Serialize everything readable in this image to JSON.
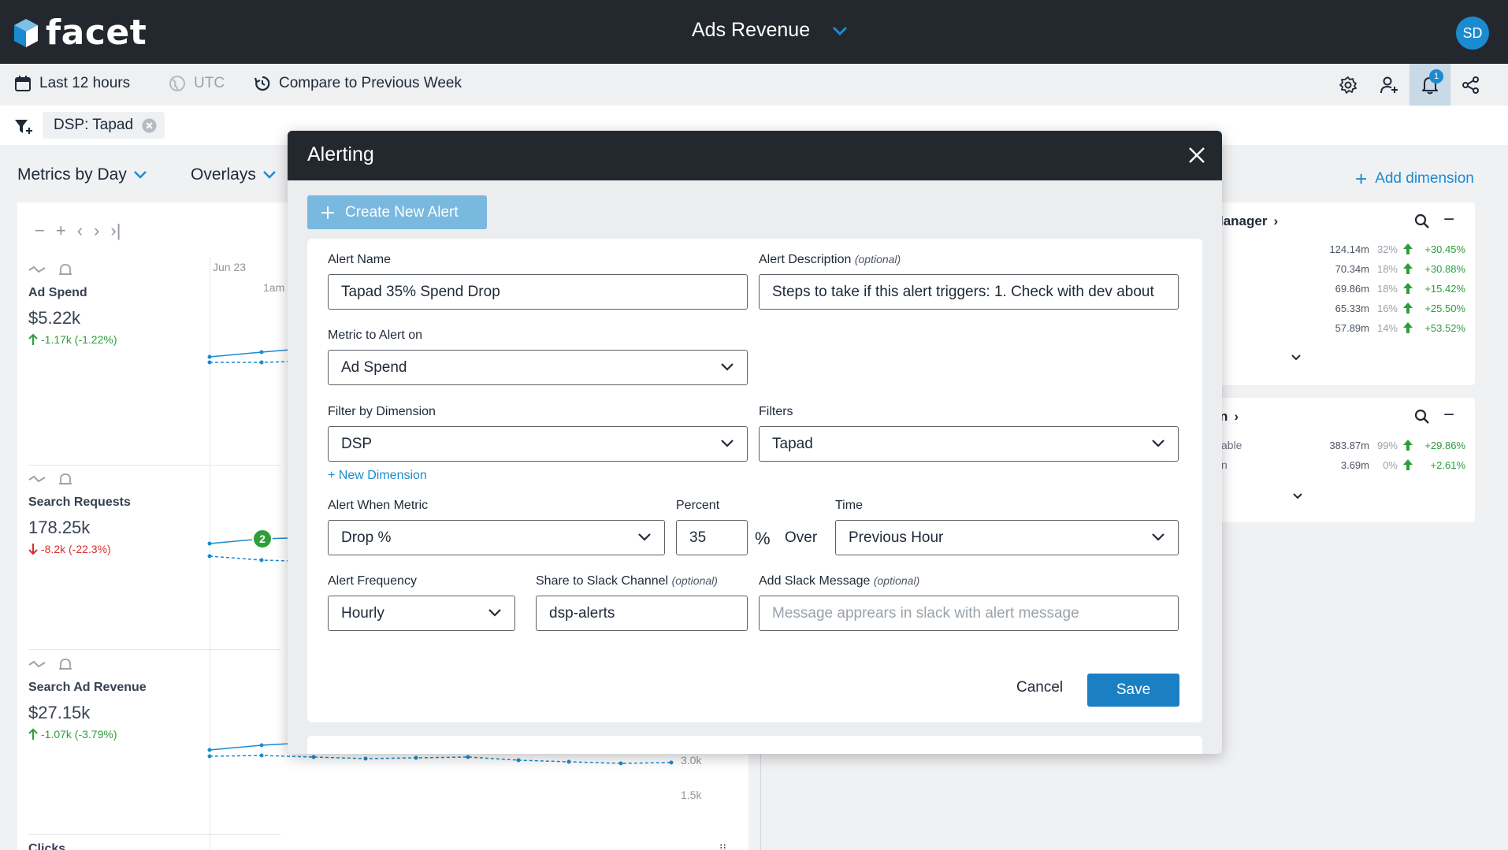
{
  "app": {
    "logo_text": "facet",
    "dashboard_title": "Ads Revenue",
    "avatar_initials": "SD"
  },
  "toolbar": {
    "time_range": "Last 12 hours",
    "timezone": "UTC",
    "compare": "Compare to Previous Week",
    "notification_count": "1"
  },
  "filters": {
    "chip_label": "DSP: Tapad"
  },
  "background": {
    "metrics_label": "Metrics by Day",
    "overlays_label": "Overlays",
    "add_dimension": "Add dimension",
    "chart_date": "Jun 23",
    "chart_time": "1am",
    "y_ticks": [
      "3.0k",
      "1.5k"
    ],
    "annotation_count": "2",
    "metrics": [
      {
        "title": "Ad Spend",
        "value": "$5.22k",
        "delta": "-1.17k (-1.22%)",
        "direction": "up",
        "color": "#2e9e3a"
      },
      {
        "title": "Search Requests",
        "value": "178.25k",
        "delta": "-8.2k (-22.3%)",
        "direction": "down",
        "color": "#d6312b"
      },
      {
        "title": "Search Ad Revenue",
        "value": "$27.15k",
        "delta": "-1.07k (-3.79%)",
        "direction": "up",
        "color": "#2e9e3a"
      },
      {
        "title": "Clicks"
      }
    ],
    "panel1": {
      "heading": "lanager",
      "rows": [
        {
          "value": "124.14m",
          "pct": "32%",
          "change": "+30.45%"
        },
        {
          "value": "70.34m",
          "pct": "18%",
          "change": "+30.88%"
        },
        {
          "value": "69.86m",
          "pct": "18%",
          "change": "+15.42%"
        },
        {
          "value": "65.33m",
          "pct": "16%",
          "change": "+25.50%"
        },
        {
          "value": "57.89m",
          "pct": "14%",
          "change": "+53.52%"
        }
      ]
    },
    "panel2": {
      "heading": "n",
      "rows": [
        {
          "label": "able",
          "value": "383.87m",
          "pct": "99%",
          "change": "+29.86%"
        },
        {
          "label": "n",
          "value": "3.69m",
          "pct": "0%",
          "change": "+2.61%"
        }
      ]
    }
  },
  "modal": {
    "title": "Alerting",
    "create_button": "Create New Alert",
    "alert_name_label": "Alert Name",
    "alert_name_value": "Tapad 35% Spend Drop",
    "description_label": "Alert Description",
    "description_optional": "(optional)",
    "description_value": "Steps to take if this alert triggers:  1. Check with dev about",
    "metric_label": "Metric to Alert on",
    "metric_value": "Ad Spend",
    "filter_dim_label": "Filter by Dimension",
    "filter_dim_value": "DSP",
    "filters_label": "Filters",
    "filters_value": "Tapad",
    "new_dimension": "+ New Dimension",
    "alert_when_label": "Alert When Metric",
    "alert_when_value": "Drop %",
    "percent_label": "Percent",
    "percent_value": "35",
    "percent_unit": "%",
    "over_text": "Over",
    "time_label": "Time",
    "time_value": "Previous Hour",
    "frequency_label": "Alert Frequency",
    "frequency_value": "Hourly",
    "slack_channel_label": "Share to Slack Channel",
    "slack_channel_optional": "(optional)",
    "slack_channel_value": "dsp-alerts",
    "slack_message_label": "Add Slack Message",
    "slack_message_optional": "(optional)",
    "slack_message_placeholder": "Message apprears in slack with alert message",
    "cancel": "Cancel",
    "save": "Save"
  },
  "colors": {
    "accent": "#1b8bd0",
    "header_bg": "#23282e",
    "save_bg": "#1b7fc4",
    "create_bg": "#79b8df"
  }
}
